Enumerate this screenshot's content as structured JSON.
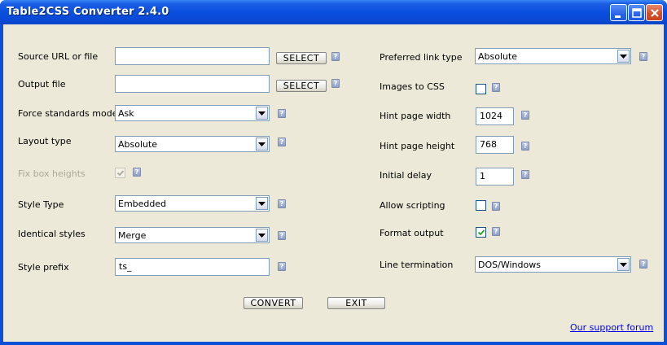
{
  "window": {
    "title": "Table2CSS Converter 2.4.0"
  },
  "buttons": {
    "select": "SELECT",
    "convert": "CONVERT",
    "exit": "EXIT",
    "help": "?"
  },
  "left": {
    "source_url_label": "Source URL or file",
    "source_url_value": "",
    "output_file_label": "Output file",
    "output_file_value": "",
    "force_standards_label": "Force standards mode",
    "force_standards_value": "Ask",
    "layout_type_label": "Layout type",
    "layout_type_value": "Absolute",
    "fix_box_heights_label": "Fix box heights",
    "fix_box_heights_checked": true,
    "style_type_label": "Style Type",
    "style_type_value": "Embedded",
    "identical_styles_label": "Identical styles",
    "identical_styles_value": "Merge",
    "style_prefix_label": "Style prefix",
    "style_prefix_value": "ts_"
  },
  "right": {
    "preferred_link_label": "Preferred link type",
    "preferred_link_value": "Absolute",
    "images_to_css_label": "Images to CSS",
    "images_to_css_checked": false,
    "hint_width_label": "Hint page width",
    "hint_width_value": "1024",
    "hint_height_label": "Hint page height",
    "hint_height_value": "768",
    "initial_delay_label": "Initial delay",
    "initial_delay_value": "1",
    "allow_scripting_label": "Allow scripting",
    "allow_scripting_checked": false,
    "format_output_label": "Format output",
    "format_output_checked": true,
    "line_termination_label": "Line termination",
    "line_termination_value": "DOS/Windows"
  },
  "footer": {
    "support_link": "Our support forum"
  }
}
